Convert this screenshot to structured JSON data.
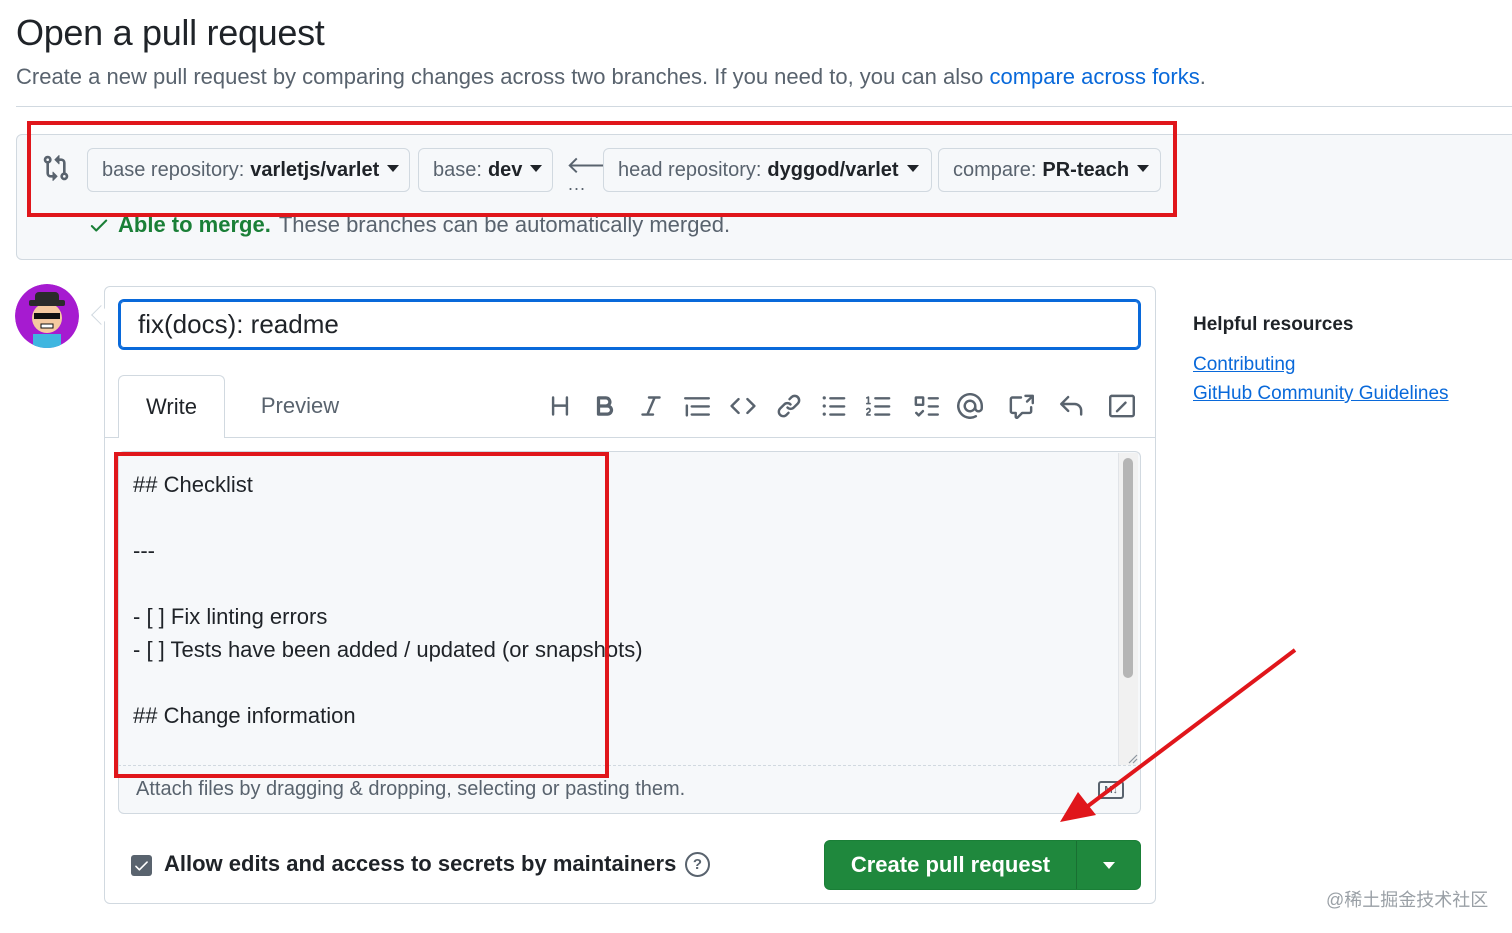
{
  "header": {
    "title": "Open a pull request",
    "subtitle": "Create a new pull request by comparing changes across two branches. If you need to, you can also ",
    "forks_link": "compare across forks",
    "subtitle_end": "."
  },
  "compare": {
    "base_repo_label": "base repository:",
    "base_repo_value": "varletjs/varlet",
    "base_label": "base:",
    "base_value": "dev",
    "head_repo_label": "head repository:",
    "head_repo_value": "dyggod/varlet",
    "compare_label": "compare:",
    "compare_value": "PR-teach",
    "dots": "...",
    "merge_ok": "Able to merge.",
    "merge_text": "These branches can be automatically merged."
  },
  "form": {
    "title_value": "fix(docs): readme",
    "tabs": [
      {
        "label": "Write",
        "active": true
      },
      {
        "label": "Preview",
        "active": false
      }
    ],
    "toolbar": [
      {
        "icon": "heading-icon"
      },
      {
        "icon": "bold-icon"
      },
      {
        "icon": "italic-icon"
      },
      {
        "icon": "quote-icon"
      },
      {
        "icon": "code-icon"
      },
      {
        "icon": "link-icon"
      },
      {
        "icon": "unordered-list-icon"
      },
      {
        "icon": "ordered-list-icon"
      },
      {
        "icon": "task-list-icon"
      },
      {
        "icon": "mention-icon"
      },
      {
        "icon": "cross-reference-icon"
      },
      {
        "icon": "reply-icon"
      },
      {
        "icon": "slash-command-icon"
      }
    ],
    "body_text": "## Checklist\n\n---\n\n- [ ] Fix linting errors\n- [ ] Tests have been added / updated (or snapshots)\n\n## Change information",
    "attach_text": "Attach files by dragging & dropping, selecting or pasting them.",
    "markdown_badge": "M↓",
    "allow_edits_label": "Allow edits and access to secrets by maintainers",
    "allow_edits_checked": true,
    "help_glyph": "?",
    "create_button": "Create pull request"
  },
  "sidebar": {
    "title": "Helpful resources",
    "links": [
      "Contributing",
      "GitHub Community Guidelines"
    ]
  },
  "watermark": "@稀土掘金技术社区",
  "colors": {
    "accent_blue": "#0969da",
    "success_green": "#1f883d",
    "annotation_red": "#e0161b"
  }
}
